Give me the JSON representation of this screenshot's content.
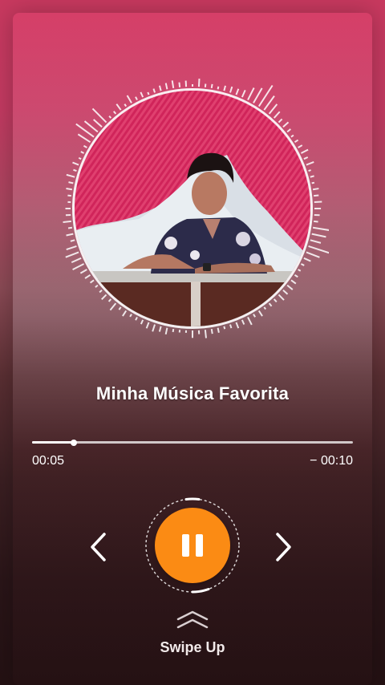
{
  "player": {
    "track_title": "Minha Música Favorita",
    "elapsed": "00:05",
    "remaining": "− 00:10",
    "progress_fraction": 0.13,
    "state": "playing"
  },
  "controls": {
    "prev_icon": "chevron-left-icon",
    "play_pause_icon": "pause-icon",
    "next_icon": "chevron-right-icon"
  },
  "swipe": {
    "icon": "double-chevron-up-icon",
    "label": "Swipe Up"
  },
  "colors": {
    "accent": "#fb8b14",
    "background_top": "#c8395f",
    "background_bottom": "#241113"
  }
}
